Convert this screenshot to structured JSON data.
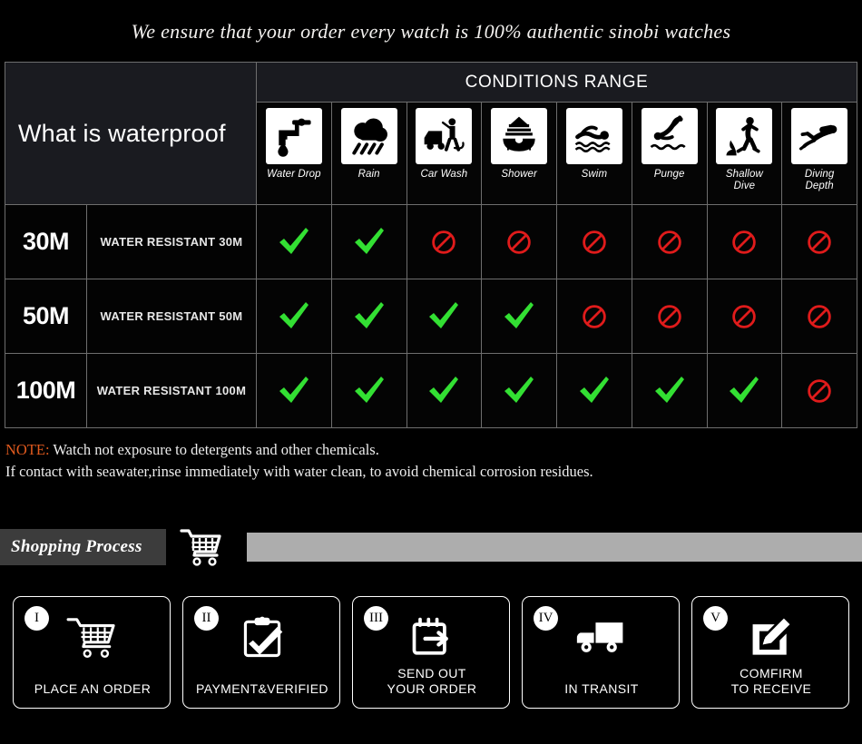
{
  "headline": "We ensure that your order every watch is 100% authentic sinobi watches",
  "table": {
    "left_header": "What is waterproof",
    "conditions_title": "CONDITIONS RANGE",
    "columns": [
      {
        "label": "Water Drop",
        "icon": "water-drop-icon"
      },
      {
        "label": "Rain",
        "icon": "rain-cloud-icon"
      },
      {
        "label": "Car Wash",
        "icon": "car-wash-icon"
      },
      {
        "label": "Shower",
        "icon": "shower-bath-icon"
      },
      {
        "label": "Swim",
        "icon": "swimmer-icon"
      },
      {
        "label": "Punge",
        "icon": "plunge-dive-icon"
      },
      {
        "label": "Shallow\nDive",
        "icon": "shallow-dive-icon"
      },
      {
        "label": "Diving\nDepth",
        "icon": "scuba-diver-icon"
      }
    ],
    "rows": [
      {
        "depth": "30M",
        "description": "WATER RESISTANT  30M",
        "values": [
          "yes",
          "yes",
          "no",
          "no",
          "no",
          "no",
          "no",
          "no"
        ]
      },
      {
        "depth": "50M",
        "description": "WATER RESISTANT 50M",
        "values": [
          "yes",
          "yes",
          "yes",
          "yes",
          "no",
          "no",
          "no",
          "no"
        ]
      },
      {
        "depth": "100M",
        "description": "WATER RESISTANT  100M",
        "values": [
          "yes",
          "yes",
          "yes",
          "yes",
          "yes",
          "yes",
          "yes",
          "no"
        ]
      }
    ]
  },
  "note": {
    "keyword": "NOTE:",
    "line1": " Watch not exposure to detergents and other chemicals.",
    "line2": "If contact with seawater,rinse immediately with water clean, to avoid chemical corrosion residues."
  },
  "shopping_process": {
    "tag": "Shopping Process",
    "cart_icon": "shopping-cart-icon"
  },
  "steps": [
    {
      "numeral": "I",
      "label": "PLACE AN ORDER",
      "icon": "shopping-cart-icon"
    },
    {
      "numeral": "II",
      "label": "PAYMENT&VERIFIED",
      "icon": "clipboard-check-icon"
    },
    {
      "numeral": "III",
      "label": "SEND OUT\nYOUR ORDER",
      "icon": "calendar-arrow-icon"
    },
    {
      "numeral": "IV",
      "label": "IN TRANSIT",
      "icon": "delivery-truck-icon"
    },
    {
      "numeral": "V",
      "label": "COMFIRM\nTO RECEIVE",
      "icon": "sign-document-icon"
    }
  ],
  "colors": {
    "yes": "#33e033",
    "no": "#e01b1b",
    "note_keyword": "#e05a1e",
    "tag_bg": "#3c3c3c",
    "bar": "#adadad",
    "header_bg": "#1a1b20"
  }
}
